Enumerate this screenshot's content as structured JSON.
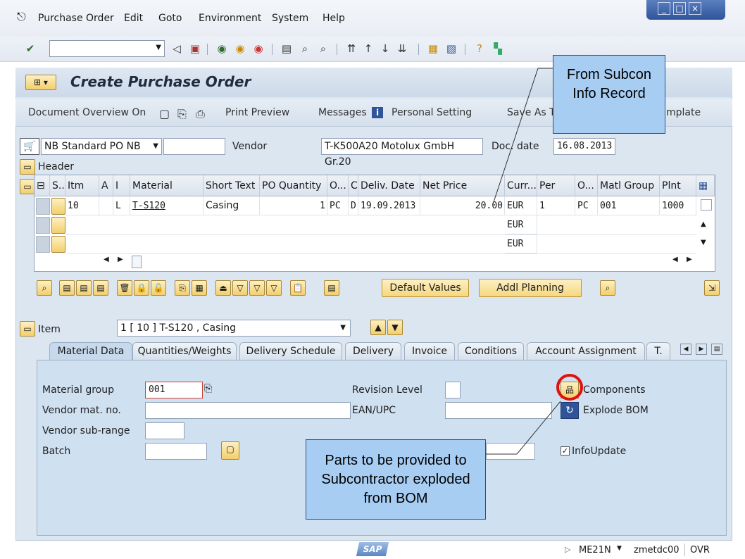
{
  "menu": {
    "items": [
      "Purchase Order",
      "Edit",
      "Goto",
      "Environment",
      "System",
      "Help"
    ]
  },
  "window_controls": [
    "_",
    "□",
    "×"
  ],
  "header": {
    "title": "Create Purchase Order"
  },
  "app_toolbar": {
    "doc_overview": "Document Overview On",
    "print_preview": "Print Preview",
    "messages": "Messages",
    "personal_setting": "Personal Setting",
    "save_as_template": "Save As T",
    "template_tail": "mplate"
  },
  "po_header": {
    "doc_type": "NB Standard PO NB",
    "vendor_label": "Vendor",
    "vendor_value": "T-K500A20 Motolux GmbH Gr.20",
    "doc_date_label": "Doc. date",
    "doc_date_value": "16.08.2013",
    "header_label": "Header"
  },
  "items_table": {
    "columns": [
      "S..",
      "Itm",
      "A",
      "I",
      "Material",
      "Short Text",
      "PO Quantity",
      "O...",
      "C",
      "Deliv. Date",
      "Net Price",
      "Curr...",
      "Per",
      "O...",
      "Matl Group",
      "Plnt"
    ],
    "rows": [
      {
        "itm": "10",
        "i": "L",
        "material": "T-S120",
        "short_text": "Casing",
        "qty": "1",
        "uom": "PC",
        "c": "D",
        "deliv": "19.09.2013",
        "price": "20.00",
        "curr": "EUR",
        "per": "1",
        "ouom": "PC",
        "matl_group": "001",
        "plnt": "1000"
      },
      {
        "curr": "EUR"
      },
      {
        "curr": "EUR"
      }
    ]
  },
  "buttons": {
    "default_values": "Default Values",
    "addl_planning": "Addl Planning"
  },
  "item_selector": {
    "label": "Item",
    "value": "1 [ 10 ] T-S120 , Casing"
  },
  "tabs": [
    "Material Data",
    "Quantities/Weights",
    "Delivery Schedule",
    "Delivery",
    "Invoice",
    "Conditions",
    "Account Assignment",
    "T."
  ],
  "material_data": {
    "material_group_label": "Material group",
    "material_group_value": "001",
    "vendor_mat_label": "Vendor mat. no.",
    "vendor_subrange_label": "Vendor sub-range",
    "batch_label": "Batch",
    "revision_label": "Revision Level",
    "ean_label": "EAN/UPC",
    "components": "Components",
    "explode_bom": "Explode BOM",
    "info_update": "InfoUpdate"
  },
  "callouts": {
    "subcon": "From Subcon Info Record",
    "parts": "Parts to be provided to Subcontractor exploded from BOM"
  },
  "status": {
    "transaction": "ME21N",
    "server": "zmetdc00",
    "mode": "OVR"
  },
  "colors": {
    "accent_blue": "#2f5499",
    "callout_bg": "#a7cdf3",
    "button_yellow": "#f6d77f",
    "highlight_red": "#e01010"
  }
}
